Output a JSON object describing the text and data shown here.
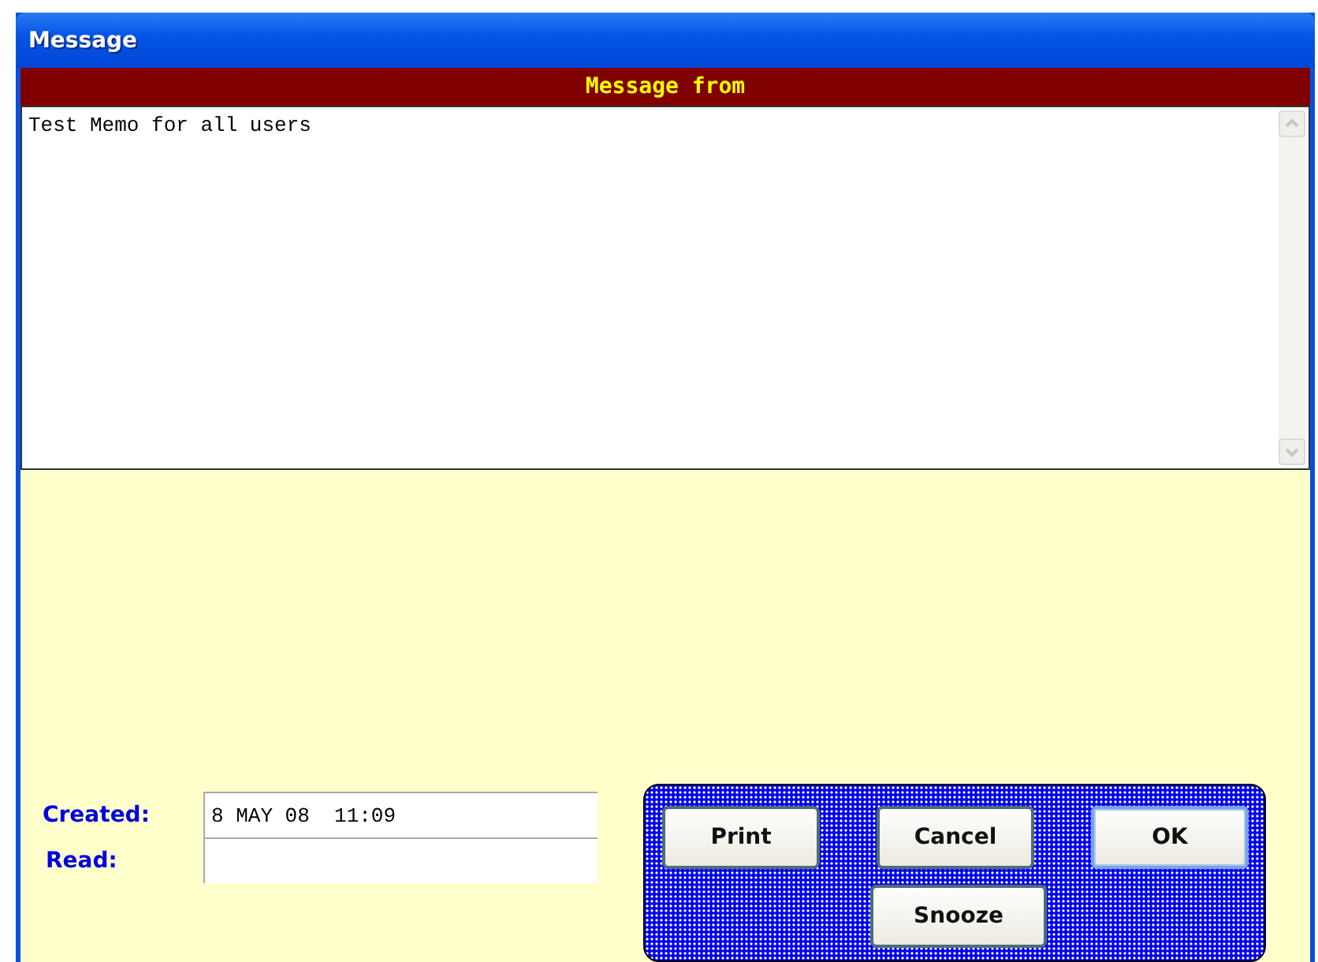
{
  "window": {
    "title": "Message"
  },
  "message": {
    "header": "Message from",
    "body": "Test Memo for all users"
  },
  "fields": [
    {
      "label": "Created:",
      "value": "8 MAY 08  11:09"
    },
    {
      "label": "Read:"
    }
  ],
  "buttons": [
    {
      "label": "Print",
      "default": false
    },
    {
      "label": "Cancel",
      "default": false
    },
    {
      "label": "OK",
      "default": true
    },
    {
      "label": "Snooze",
      "default": false
    }
  ]
}
